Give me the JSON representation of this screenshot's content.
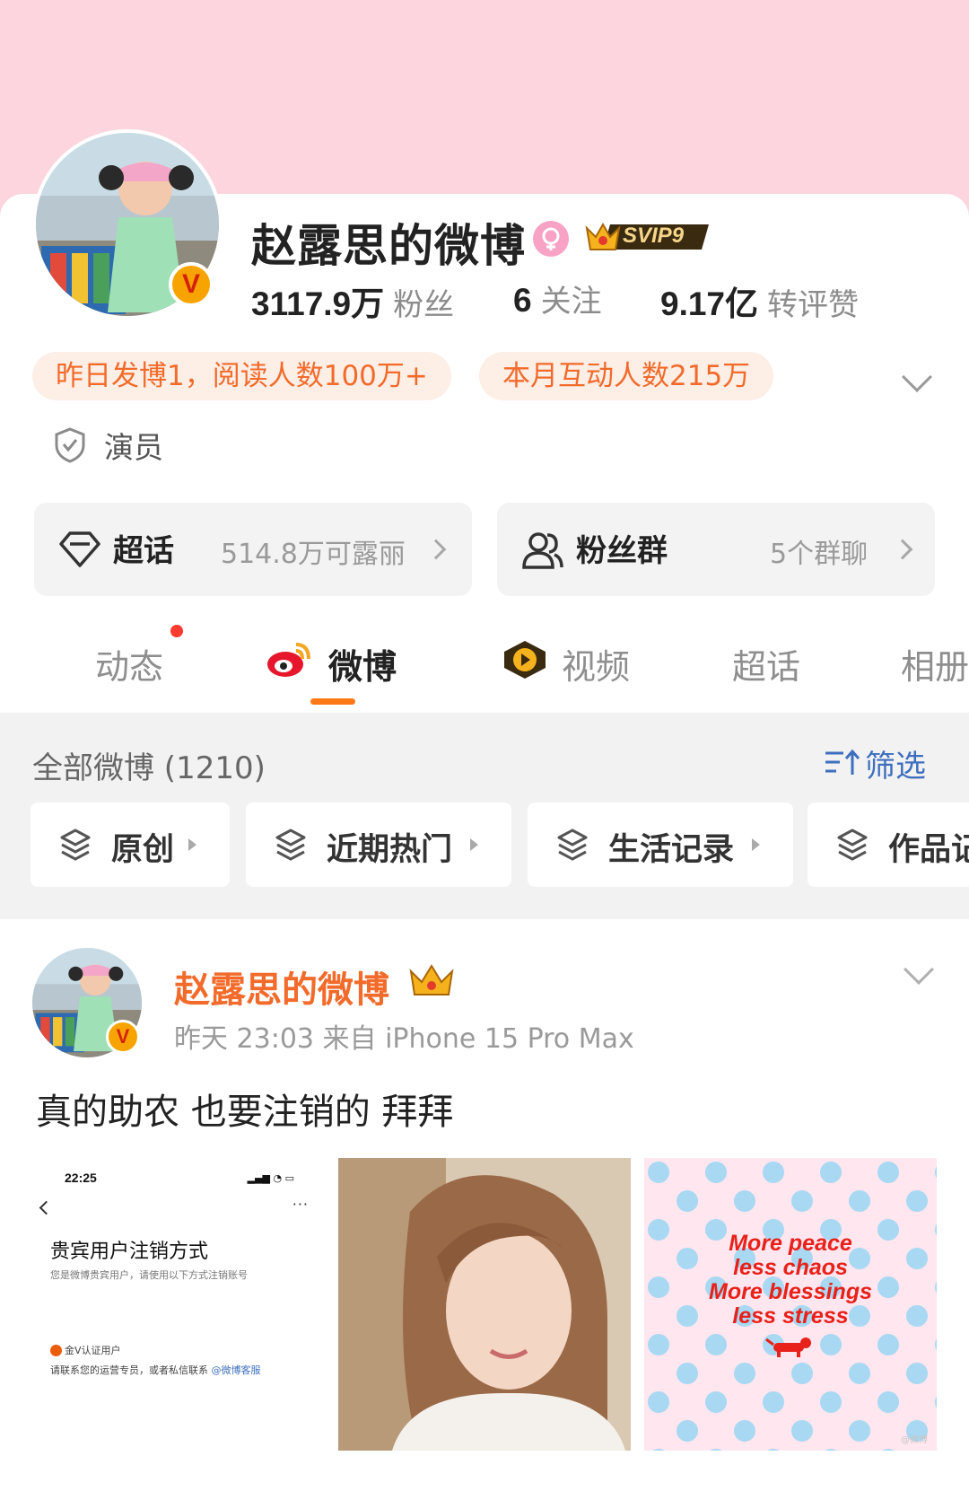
{
  "profile": {
    "name": "赵露思的微博",
    "svip_label": "SVIP9",
    "stats": [
      {
        "num": "3117.9万",
        "label": "粉丝"
      },
      {
        "num": "6",
        "label": "关注"
      },
      {
        "num": "9.17亿",
        "label": "转评赞"
      }
    ],
    "pills": [
      "昨日发博1，阅读人数100万+",
      "本月互动人数215万"
    ],
    "role": "演员",
    "badge": "V"
  },
  "entries": {
    "chaohua": {
      "title": "超话",
      "sub": "514.8万可露丽"
    },
    "fans": {
      "title": "粉丝群",
      "sub": "5个群聊"
    }
  },
  "tabs": [
    "动态",
    "微博",
    "视频",
    "超话",
    "相册"
  ],
  "filter": {
    "all_label": "全部微博 (1210)",
    "filter_label": "筛选",
    "chips": [
      "原创",
      "近期热门",
      "生活记录",
      "作品记录"
    ]
  },
  "post": {
    "author": "赵露思的微博",
    "meta": "昨天 23:03  来自 iPhone 15 Pro Max",
    "text": "真的助农 也要注销的 拜拜",
    "screenshot": {
      "time": "22:25",
      "title": "贵宾用户注销方式",
      "desc": "您是微博贵宾用户，请使用以下方式注销账号",
      "vuser": "金V认证用户",
      "contact": "请联系您的运营专员，或者私信联系 ",
      "contact_link": "@微博客服"
    },
    "poster_lines": [
      "More peace",
      "less chaos",
      "More blessings",
      "less stress"
    ],
    "watermark": "@微博"
  },
  "colors": {
    "accent": "#ff7a17",
    "link": "#3e6fbf",
    "name_orange": "#f26b2b",
    "header_pink": "#fcd5df"
  }
}
